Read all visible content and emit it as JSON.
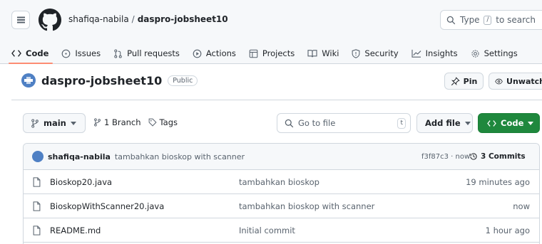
{
  "nav": {
    "owner": "shafiqa-nabila",
    "separator": "/",
    "repo": "daspro-jobsheet10",
    "search_prefix": "Type",
    "search_key": "/",
    "search_suffix": "to search"
  },
  "tabs": [
    {
      "label": "Code",
      "icon": "code-icon"
    },
    {
      "label": "Issues",
      "icon": "issue-icon"
    },
    {
      "label": "Pull requests",
      "icon": "pull-request-icon"
    },
    {
      "label": "Actions",
      "icon": "play-icon"
    },
    {
      "label": "Projects",
      "icon": "table-icon"
    },
    {
      "label": "Wiki",
      "icon": "book-icon"
    },
    {
      "label": "Security",
      "icon": "shield-icon"
    },
    {
      "label": "Insights",
      "icon": "graph-icon"
    },
    {
      "label": "Settings",
      "icon": "gear-icon"
    }
  ],
  "repo_header": {
    "title": "daspro-jobsheet10",
    "visibility": "Public",
    "pin_label": "Pin",
    "watch_label": "Unwatch"
  },
  "toolbar": {
    "branch": "main",
    "branch_count": "1 Branch",
    "tags": "Tags",
    "goto_placeholder": "Go to file",
    "goto_key": "t",
    "add_file": "Add file",
    "code_button": "Code"
  },
  "commit": {
    "user": "shafiqa-nabila",
    "message": "tambahkan bioskop with scanner",
    "meta": "f3f87c3 · now",
    "count": "3 Commits"
  },
  "files": [
    {
      "name": "Bioskop20.java",
      "message": "tambahkan bioskop",
      "date": "19 minutes ago"
    },
    {
      "name": "BioskopWithScanner20.java",
      "message": "tambahkan bioskop with scanner",
      "date": "now"
    },
    {
      "name": "README.md",
      "message": "Initial commit",
      "date": "1 hour ago"
    }
  ],
  "colors": {
    "accent_green": "#1f883d",
    "tab_underline": "#fd8c73",
    "header_bg": "#f6f8fa"
  }
}
